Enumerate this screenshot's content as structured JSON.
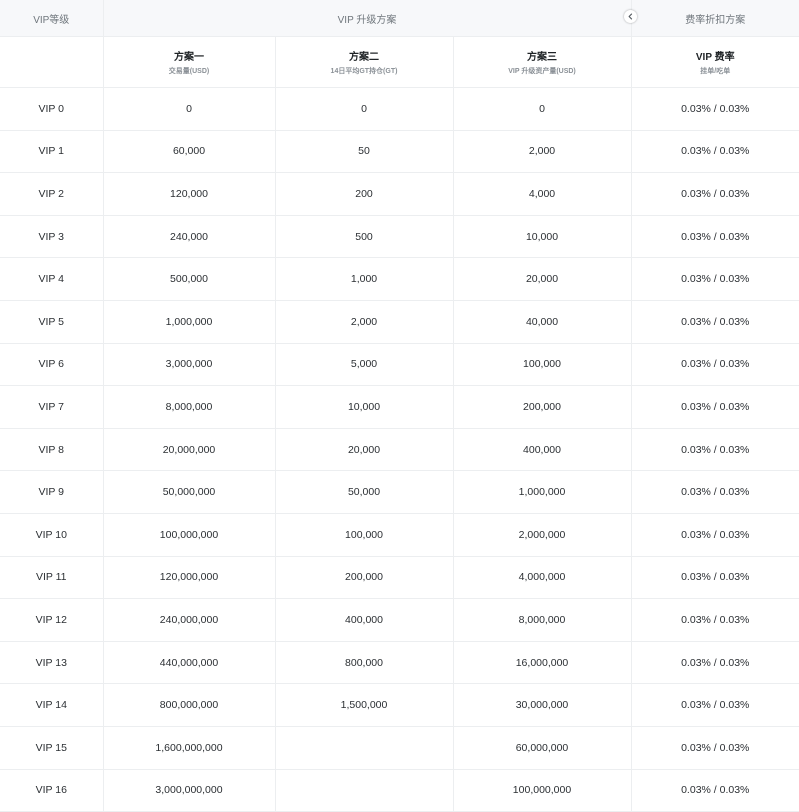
{
  "header": {
    "level_col": "VIP等级",
    "upgrade_group": "VIP 升级方案",
    "discount_group": "费率折扣方案",
    "plans": [
      {
        "title": "方案一",
        "subtitle": "交易量(USD)"
      },
      {
        "title": "方案二",
        "subtitle": "14日平均GT持仓(GT)"
      },
      {
        "title": "方案三",
        "subtitle": "VIP 升级资产量(USD)"
      }
    ],
    "fee": {
      "title": "VIP 费率",
      "subtitle": "挂单/吃单"
    }
  },
  "scroll_icon": "chevron-left-icon",
  "rows": [
    [
      "VIP 0",
      "0",
      "0",
      "0",
      "0.03% / 0.03%"
    ],
    [
      "VIP 1",
      "60,000",
      "50",
      "2,000",
      "0.03% / 0.03%"
    ],
    [
      "VIP 2",
      "120,000",
      "200",
      "4,000",
      "0.03% / 0.03%"
    ],
    [
      "VIP 3",
      "240,000",
      "500",
      "10,000",
      "0.03% / 0.03%"
    ],
    [
      "VIP 4",
      "500,000",
      "1,000",
      "20,000",
      "0.03% / 0.03%"
    ],
    [
      "VIP 5",
      "1,000,000",
      "2,000",
      "40,000",
      "0.03% / 0.03%"
    ],
    [
      "VIP 6",
      "3,000,000",
      "5,000",
      "100,000",
      "0.03% / 0.03%"
    ],
    [
      "VIP 7",
      "8,000,000",
      "10,000",
      "200,000",
      "0.03% / 0.03%"
    ],
    [
      "VIP 8",
      "20,000,000",
      "20,000",
      "400,000",
      "0.03% / 0.03%"
    ],
    [
      "VIP 9",
      "50,000,000",
      "50,000",
      "1,000,000",
      "0.03% / 0.03%"
    ],
    [
      "VIP 10",
      "100,000,000",
      "100,000",
      "2,000,000",
      "0.03% / 0.03%"
    ],
    [
      "VIP 11",
      "120,000,000",
      "200,000",
      "4,000,000",
      "0.03% / 0.03%"
    ],
    [
      "VIP 12",
      "240,000,000",
      "400,000",
      "8,000,000",
      "0.03% / 0.03%"
    ],
    [
      "VIP 13",
      "440,000,000",
      "800,000",
      "16,000,000",
      "0.03% / 0.03%"
    ],
    [
      "VIP 14",
      "800,000,000",
      "1,500,000",
      "30,000,000",
      "0.03% / 0.03%"
    ],
    [
      "VIP 15",
      "1,600,000,000",
      "",
      "60,000,000",
      "0.03% / 0.03%"
    ],
    [
      "VIP 16",
      "3,000,000,000",
      "",
      "100,000,000",
      "0.03% / 0.03%"
    ]
  ]
}
